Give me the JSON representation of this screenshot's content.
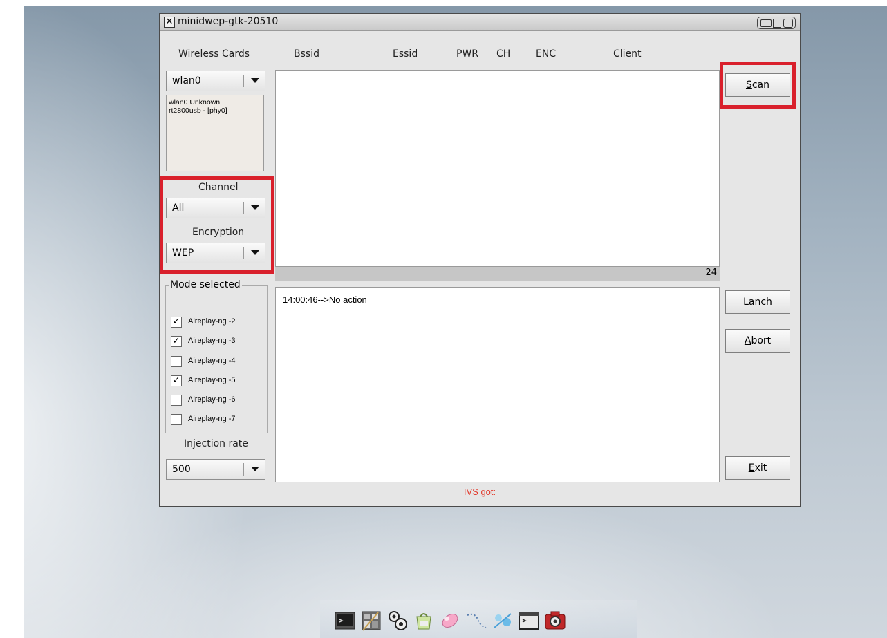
{
  "window": {
    "title": "minidwep-gtk-20510"
  },
  "wireless_cards": {
    "label": "Wireless Cards",
    "selected": "wlan0",
    "info_line1": "wlan0 Unknown",
    "info_line2": "rt2800usb - [phy0]"
  },
  "table_headers": [
    "Bssid",
    "Essid",
    "PWR",
    "CH",
    "ENC",
    "Client"
  ],
  "channel": {
    "label": "Channel",
    "selected": "All"
  },
  "encryption": {
    "label": "Encryption",
    "selected": "WEP"
  },
  "status_count": "24",
  "mode": {
    "label": "Mode selected",
    "options": [
      {
        "label": "Aireplay-ng -2",
        "checked": true
      },
      {
        "label": "Aireplay-ng -3",
        "checked": true
      },
      {
        "label": "Aireplay-ng -4",
        "checked": false
      },
      {
        "label": "Aireplay-ng -5",
        "checked": true
      },
      {
        "label": "Aireplay-ng -6",
        "checked": false
      },
      {
        "label": "Aireplay-ng -7",
        "checked": false
      }
    ]
  },
  "injection": {
    "label": "Injection rate",
    "selected": "500"
  },
  "log": {
    "line": "14:00:46-->No action"
  },
  "buttons": {
    "scan": {
      "first": "S",
      "rest": "can"
    },
    "lanch": {
      "first": "L",
      "rest": "anch"
    },
    "abort": {
      "first": "A",
      "rest": "bort"
    },
    "exit": {
      "first": "E",
      "rest": "xit"
    }
  },
  "ivs_label": "IVS got:",
  "check_glyph": "✓",
  "close_glyph": "✕",
  "highlight_color": "#d9202c",
  "dock": {
    "icons": [
      "terminal-icon",
      "calculator-icon",
      "gears-icon",
      "bag-icon",
      "pill-icon",
      "swirl-icon",
      "network-icon",
      "console-icon",
      "camera-settings-icon"
    ]
  }
}
